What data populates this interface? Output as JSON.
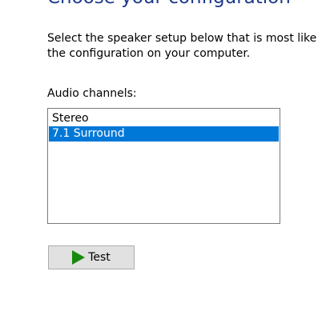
{
  "header": {
    "title": "Choose your configuration"
  },
  "description": {
    "line1": "Select the speaker setup below that is most like",
    "line2": "the configuration on your computer."
  },
  "audio_channels": {
    "label": "Audio channels:",
    "options": [
      {
        "label": "Stereo",
        "selected": false
      },
      {
        "label": "7.1 Surround",
        "selected": true
      }
    ]
  },
  "test_button": {
    "label": "Test",
    "icon": "play-icon"
  },
  "colors": {
    "heading": "#1e3a8a",
    "selection": "#0078d7",
    "play_icon": "#17890f",
    "button_bg": "#e1e1e1",
    "button_border": "#adadad"
  }
}
